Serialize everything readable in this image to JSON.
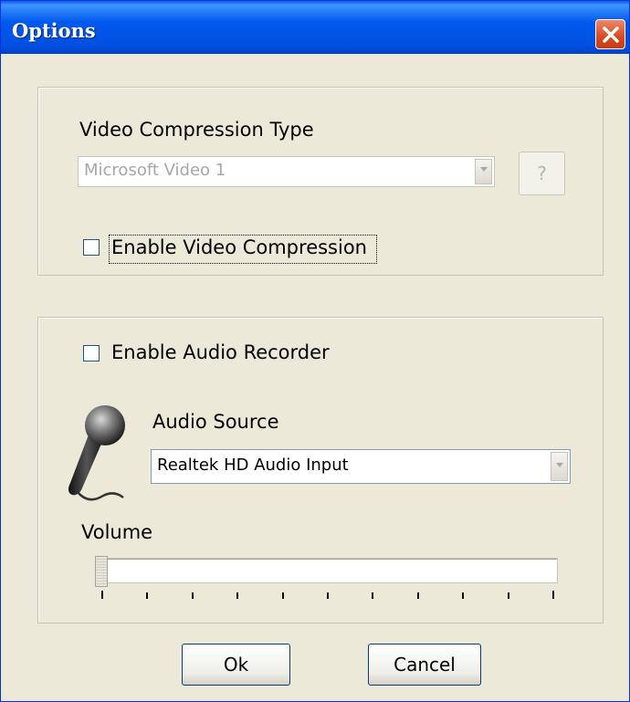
{
  "window": {
    "title": "Options"
  },
  "video": {
    "compression_type_label": "Video Compression Type",
    "compression_codec": "Microsoft Video 1",
    "help_button_label": "?",
    "enable_compression_label": "Enable Video Compression",
    "enable_compression_checked": false
  },
  "audio": {
    "enable_recorder_label": "Enable Audio Recorder",
    "enable_recorder_checked": false,
    "source_label": "Audio Source",
    "source_value": "Realtek HD Audio Input",
    "volume_label": "Volume",
    "volume_level": 0
  },
  "buttons": {
    "ok_label": "Ok",
    "cancel_label": "Cancel"
  },
  "colors": {
    "titlebar": "#0058ee",
    "close": "#d9491f",
    "dialog_bg": "#ece9d8"
  },
  "icons": [
    "close-icon",
    "dropdown-arrow-icon",
    "microphone-icon"
  ]
}
